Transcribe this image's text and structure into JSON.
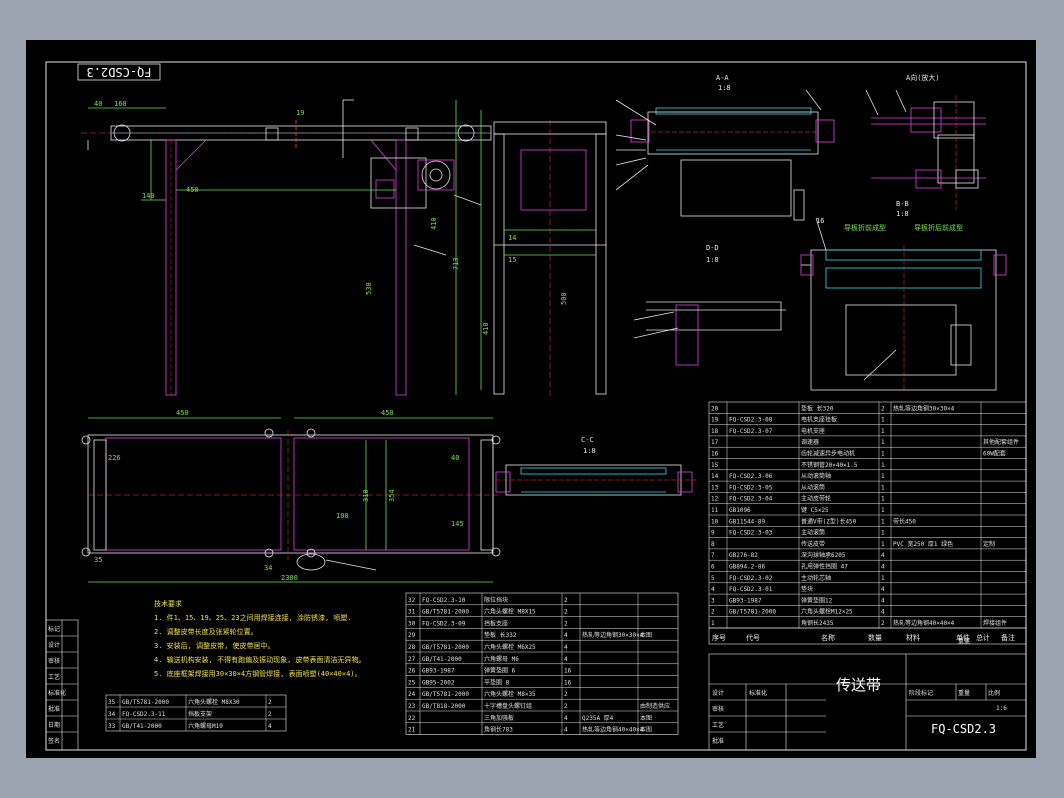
{
  "drawing_number": "FQ-CSD2.3",
  "drawing_number_rotated": "FQ-CSD2.3",
  "drawing_name": "传送带",
  "scale": "1:6",
  "views": {
    "aa": "A-A",
    "aa_scale": "1:8",
    "a_dir": "A向(放大)",
    "bb": "B-B",
    "bb_scale": "1:8",
    "cc": "C-C",
    "cc_scale": "1:8",
    "dd": "D-D",
    "dd_scale": "1:8"
  },
  "callouts": {
    "board_before": "导板折前成型",
    "board_after": "导板折后前成型"
  },
  "dims": {
    "d40": "40",
    "d160": "160",
    "d140": "140",
    "d450": "450",
    "d19": "19",
    "d713": "713",
    "d530": "530",
    "d410": "410",
    "d410b": "410",
    "d500": "500",
    "d14": "14",
    "d15": "15",
    "top450a": "450",
    "top450b": "450",
    "d226": "226",
    "d100": "100",
    "d310": "310",
    "d354": "354",
    "d145": "145",
    "d40b": "40",
    "d35": "35",
    "d34": "34",
    "d2300": "2300",
    "d16": "16"
  },
  "tech_heading": "技术要求",
  "tech_notes": [
    "1. 件1、15、19、25、23之间用焊接连接, 涂防锈漆, 喷塑.",
    "2. 调整皮带长度及张紧轮位置。",
    "3. 安装后, 调整皮带, 使皮带居中。",
    "4. 输送机构安装, 不得有跑偏及振动现象, 皮带表面清洁无异物。",
    "5. 底座框架焊接用30×30×4方钢管焊接, 表面喷塑(40×40×4)。"
  ],
  "left_strip": [
    "标记",
    "设计",
    "审核",
    "工艺",
    "标准化",
    "批准",
    "日期",
    "签名"
  ],
  "right_bom": [
    {
      "no": "20",
      "code": "",
      "name": "垫板 长320",
      "qty": "2",
      "mat": "热轧等边角钢30×30×4",
      "note": ""
    },
    {
      "no": "19",
      "code": "FQ-CSD2.3-08",
      "name": "电机支座挂板",
      "qty": "1",
      "mat": "",
      "note": ""
    },
    {
      "no": "18",
      "code": "FQ-CSD2.3-07",
      "name": "电机支座",
      "qty": "1",
      "mat": "",
      "note": ""
    },
    {
      "no": "17",
      "code": "",
      "name": "调速器",
      "qty": "1",
      "mat": "",
      "note": "其他配套组件"
    },
    {
      "no": "16",
      "code": "",
      "name": "齿轮减速异步电动机",
      "qty": "1",
      "mat": "",
      "note": "60W配套"
    },
    {
      "no": "15",
      "code": "",
      "name": "不锈钢管20×40×1.5",
      "qty": "1",
      "mat": "",
      "note": ""
    },
    {
      "no": "14",
      "code": "FQ-CSD2.3-06",
      "name": "从动滚筒轴",
      "qty": "1",
      "mat": "",
      "note": ""
    },
    {
      "no": "13",
      "code": "FQ-CSD2.3-05",
      "name": "从动滚筒",
      "qty": "1",
      "mat": "",
      "note": ""
    },
    {
      "no": "12",
      "code": "FQ-CSD2.3-04",
      "name": "主动皮带轮",
      "qty": "1",
      "mat": "",
      "note": ""
    },
    {
      "no": "11",
      "code": "GB1096",
      "name": "键 C5×25",
      "qty": "1",
      "mat": "",
      "note": ""
    },
    {
      "no": "10",
      "code": "GB11544-89",
      "name": "普通V带(Z型)长450",
      "qty": "1",
      "mat": "带长450",
      "note": ""
    },
    {
      "no": "9",
      "code": "FQ-CSD2.3-03",
      "name": "主动滚筒",
      "qty": "1",
      "mat": "",
      "note": ""
    },
    {
      "no": "8",
      "code": "",
      "name": "传送皮带",
      "qty": "1",
      "mat": "PVC 宽250 厚1 绿色",
      "note": "定制"
    },
    {
      "no": "7",
      "code": "GB276-82",
      "name": "深沟球轴承6205",
      "qty": "4",
      "mat": "",
      "note": ""
    },
    {
      "no": "6",
      "code": "GB894.2-86",
      "name": "孔用弹性挡圈 47",
      "qty": "4",
      "mat": "",
      "note": ""
    },
    {
      "no": "5",
      "code": "FQ-CSD2.3-02",
      "name": "主动轮芯轴",
      "qty": "1",
      "mat": "",
      "note": ""
    },
    {
      "no": "4",
      "code": "FQ-CSD2.3-01",
      "name": "垫块",
      "qty": "4",
      "mat": "",
      "note": ""
    },
    {
      "no": "3",
      "code": "GB93-1987",
      "name": "弹簧垫圈12",
      "qty": "4",
      "mat": "",
      "note": ""
    },
    {
      "no": "2",
      "code": "GB/T5781-2000",
      "name": "六角头螺栓M12×25",
      "qty": "4",
      "mat": "",
      "note": ""
    },
    {
      "no": "1",
      "code": "",
      "name": "角钢长2435",
      "qty": "2",
      "mat": "热轧等边角钢40×40×4",
      "note": "焊接组件"
    }
  ],
  "right_bom_header": {
    "no": "序号",
    "code": "代号",
    "name": "名称",
    "qty": "数量",
    "mat": "材料",
    "unit": "单件",
    "total": "总计",
    "weight": "重量",
    "note": "备注"
  },
  "mid_bom": [
    {
      "no": "32",
      "code": "FQ-CSD2.3-10",
      "name": "限位挡块",
      "qty": "2",
      "mat": "",
      "note": ""
    },
    {
      "no": "31",
      "code": "GB/T5781-2000",
      "name": "六角头螺栓 M8X15",
      "qty": "2",
      "mat": "",
      "note": ""
    },
    {
      "no": "30",
      "code": "FQ-CSD2.3-09",
      "name": "挡板支座",
      "qty": "2",
      "mat": "",
      "note": ""
    },
    {
      "no": "29",
      "code": "",
      "name": "垫板 长332",
      "qty": "4",
      "mat": "热轧等边角钢30×30×4",
      "note": "本图"
    },
    {
      "no": "28",
      "code": "GB/T5781-2000",
      "name": "六角头螺栓 M6X25",
      "qty": "4",
      "mat": "",
      "note": ""
    },
    {
      "no": "27",
      "code": "GB/T41-2000",
      "name": "六角螺母 M6",
      "qty": "4",
      "mat": "",
      "note": ""
    },
    {
      "no": "26",
      "code": "GB93-1987",
      "name": "弹簧垫圈 6",
      "qty": "16",
      "mat": "",
      "note": ""
    },
    {
      "no": "25",
      "code": "GB95-2002",
      "name": "平垫圈 8",
      "qty": "16",
      "mat": "",
      "note": ""
    },
    {
      "no": "24",
      "code": "GB/T5781-2000",
      "name": "六角头螺栓 M8×35",
      "qty": "2",
      "mat": "",
      "note": ""
    },
    {
      "no": "23",
      "code": "GB/T818-2000",
      "name": "十字槽盘头螺钉组",
      "qty": "2",
      "mat": "",
      "note": "由制造供应"
    },
    {
      "no": "22",
      "code": "",
      "name": "三角加强板",
      "qty": "4",
      "mat": "Q235A 厚4",
      "note": "本图"
    },
    {
      "no": "21",
      "code": "",
      "name": "角钢长783",
      "qty": "4",
      "mat": "热轧等边角钢40×40×4",
      "note": "本图"
    }
  ],
  "low_bom": [
    {
      "no": "35",
      "code": "GB/T5781-2000",
      "name": "六角头螺栓 M8X30",
      "qty": "2"
    },
    {
      "no": "34",
      "code": "FQ-CSD2.3-11",
      "name": "挡板支架",
      "qty": "2"
    },
    {
      "no": "33",
      "code": "GB/T41-2000",
      "name": "六角螺母M10",
      "qty": "4"
    }
  ],
  "title_block": {
    "stage_label": "阶段标记",
    "weight_label": "重量",
    "scale_label": "比例",
    "row_labels": [
      "标记",
      "处数",
      "分区",
      "更改文件号",
      "签名",
      "年月日"
    ],
    "sign_labels": [
      "设计",
      "审核",
      "工艺",
      "标准化",
      "批准"
    ]
  },
  "colors": {
    "line": "#e6e6e6",
    "magenta": "#e23fe2",
    "cyan": "#3ad9e8",
    "green": "#69e04a",
    "yellow": "#f2e24a",
    "red": "#ff3b3b",
    "blue": "#5f73ff",
    "bg": "#000000",
    "frame": "#9ba3b1"
  }
}
